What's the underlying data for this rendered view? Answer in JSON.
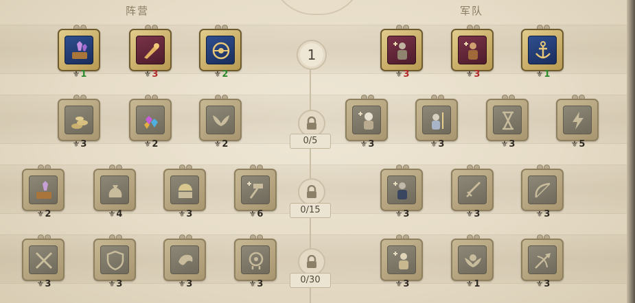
{
  "sections": {
    "left_title": "阵营",
    "right_title": "军队"
  },
  "current_level": "1",
  "tiers": [
    {
      "requirement": "0/5"
    },
    {
      "requirement": "0/15"
    },
    {
      "requirement": "0/30"
    }
  ],
  "nodes": [
    {
      "id": "c1",
      "icon": "purple-crystals-icon",
      "level": "1",
      "state": "active",
      "theme": "blue",
      "level_color": "#2c8a2c"
    },
    {
      "id": "c2",
      "icon": "horn-icon",
      "level": "3",
      "state": "active",
      "theme": "red",
      "level_color": "#b02a2a"
    },
    {
      "id": "c3",
      "icon": "target-eye-icon",
      "level": "2",
      "state": "active",
      "theme": "blue",
      "level_color": "#2c8a2c"
    },
    {
      "id": "a1",
      "icon": "soldier-icon",
      "level": "3",
      "state": "active",
      "theme": "red",
      "level_color": "#b02a2a"
    },
    {
      "id": "a2",
      "icon": "warrior-icon",
      "level": "3",
      "state": "active",
      "theme": "red",
      "level_color": "#b02a2a"
    },
    {
      "id": "a3",
      "icon": "anchor-icon",
      "level": "1",
      "state": "active",
      "theme": "blue",
      "level_color": "#2c8a2c"
    },
    {
      "id": "c4",
      "icon": "gold-coins-icon",
      "level": "3"
    },
    {
      "id": "c5",
      "icon": "gems-icon",
      "level": "2"
    },
    {
      "id": "c6",
      "icon": "wings-icon",
      "level": "2"
    },
    {
      "id": "a4",
      "icon": "knight-icon",
      "level": "3"
    },
    {
      "id": "a5",
      "icon": "mage-icon",
      "level": "3"
    },
    {
      "id": "a6",
      "icon": "hourglass-icon",
      "level": "3"
    },
    {
      "id": "a7",
      "icon": "lightning-icon",
      "level": "5"
    },
    {
      "id": "c7",
      "icon": "crystals-wood-icon",
      "level": "2"
    },
    {
      "id": "c8",
      "icon": "money-bag-icon",
      "level": "4"
    },
    {
      "id": "c9",
      "icon": "sunrise-tent-icon",
      "level": "3"
    },
    {
      "id": "c10",
      "icon": "hammer-icon",
      "level": "6"
    },
    {
      "id": "a8",
      "icon": "swordsman-icon",
      "level": "3"
    },
    {
      "id": "a9",
      "icon": "sword-icon",
      "level": "3"
    },
    {
      "id": "a10",
      "icon": "bow-icon",
      "level": "3"
    },
    {
      "id": "c11",
      "icon": "crossed-swords-icon",
      "level": "3"
    },
    {
      "id": "c12",
      "icon": "shield-icon",
      "level": "3"
    },
    {
      "id": "c13",
      "icon": "dragon-icon",
      "level": "3"
    },
    {
      "id": "c14",
      "icon": "gear-head-icon",
      "level": "3"
    },
    {
      "id": "a11",
      "icon": "scholar-icon",
      "level": "3"
    },
    {
      "id": "a12",
      "icon": "winged-emblem-icon",
      "level": "1"
    },
    {
      "id": "a13",
      "icon": "arrow-strike-icon",
      "level": "3"
    }
  ]
}
